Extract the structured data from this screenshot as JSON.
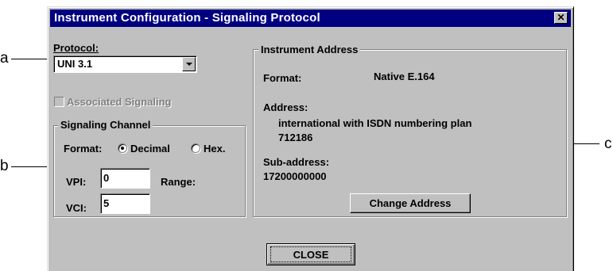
{
  "callouts": {
    "a": "a",
    "b": "b",
    "c": "c"
  },
  "window": {
    "title": "Instrument Configuration - Signaling Protocol",
    "close_glyph": "✕"
  },
  "protocol": {
    "label": "Protocol:",
    "value": "UNI 3.1"
  },
  "associated_signaling": {
    "label": "Associated Signaling",
    "checked": false,
    "enabled": false
  },
  "signaling_channel": {
    "title": "Signaling Channel",
    "format_label": "Format:",
    "format_options": [
      "Decimal",
      "Hex."
    ],
    "format_selected": "Decimal",
    "vpi_label": "VPI:",
    "vpi_value": "0",
    "vci_label": "VCI:",
    "vci_value": "5",
    "range_label": "Range:"
  },
  "instrument_address": {
    "title": "Instrument Address",
    "format_label": "Format:",
    "format_value": "Native E.164",
    "address_label": "Address:",
    "address_type": "international with ISDN numbering plan",
    "address_number": "712186",
    "subaddress_label": "Sub-address:",
    "subaddress_value": "17200000000",
    "change_button": "Change Address"
  },
  "close_button": "CLOSE",
  "colors": {
    "titlebar": "#000080",
    "face": "#c0c0c0"
  }
}
